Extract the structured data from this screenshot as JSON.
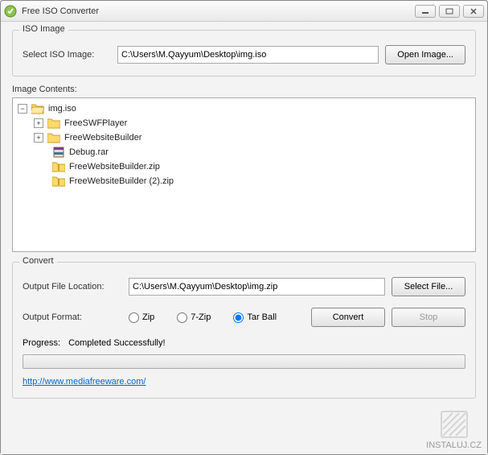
{
  "window": {
    "title": "Free ISO Converter"
  },
  "iso_image": {
    "legend": "ISO Image",
    "select_label": "Select ISO Image:",
    "path": "C:\\Users\\M.Qayyum\\Desktop\\img.iso",
    "open_btn": "Open Image..."
  },
  "contents": {
    "label": "Image Contents:",
    "tree": {
      "root": {
        "name": "img.iso",
        "icon": "folder-open",
        "expanded": true
      },
      "children": [
        {
          "name": "FreeSWFPlayer",
          "icon": "folder",
          "expandable": true
        },
        {
          "name": "FreeWebsiteBuilder",
          "icon": "folder",
          "expandable": true
        },
        {
          "name": "Debug.rar",
          "icon": "rar",
          "expandable": false
        },
        {
          "name": "FreeWebsiteBuilder.zip",
          "icon": "zip",
          "expandable": false
        },
        {
          "name": "FreeWebsiteBuilder (2).zip",
          "icon": "zip",
          "expandable": false
        }
      ]
    }
  },
  "convert": {
    "legend": "Convert",
    "output_location_label": "Output File Location:",
    "output_path": "C:\\Users\\M.Qayyum\\Desktop\\img.zip",
    "select_file_btn": "Select File...",
    "format_label": "Output Format:",
    "formats": {
      "zip": "Zip",
      "sevenzip": "7-Zip",
      "tarball": "Tar Ball"
    },
    "selected_format": "tarball",
    "convert_btn": "Convert",
    "stop_btn": "Stop",
    "progress_label": "Progress:",
    "progress_status": "Completed Successfully!"
  },
  "link": {
    "text": "http://www.mediafreeware.com/"
  },
  "watermark": "INSTALUJ.CZ"
}
